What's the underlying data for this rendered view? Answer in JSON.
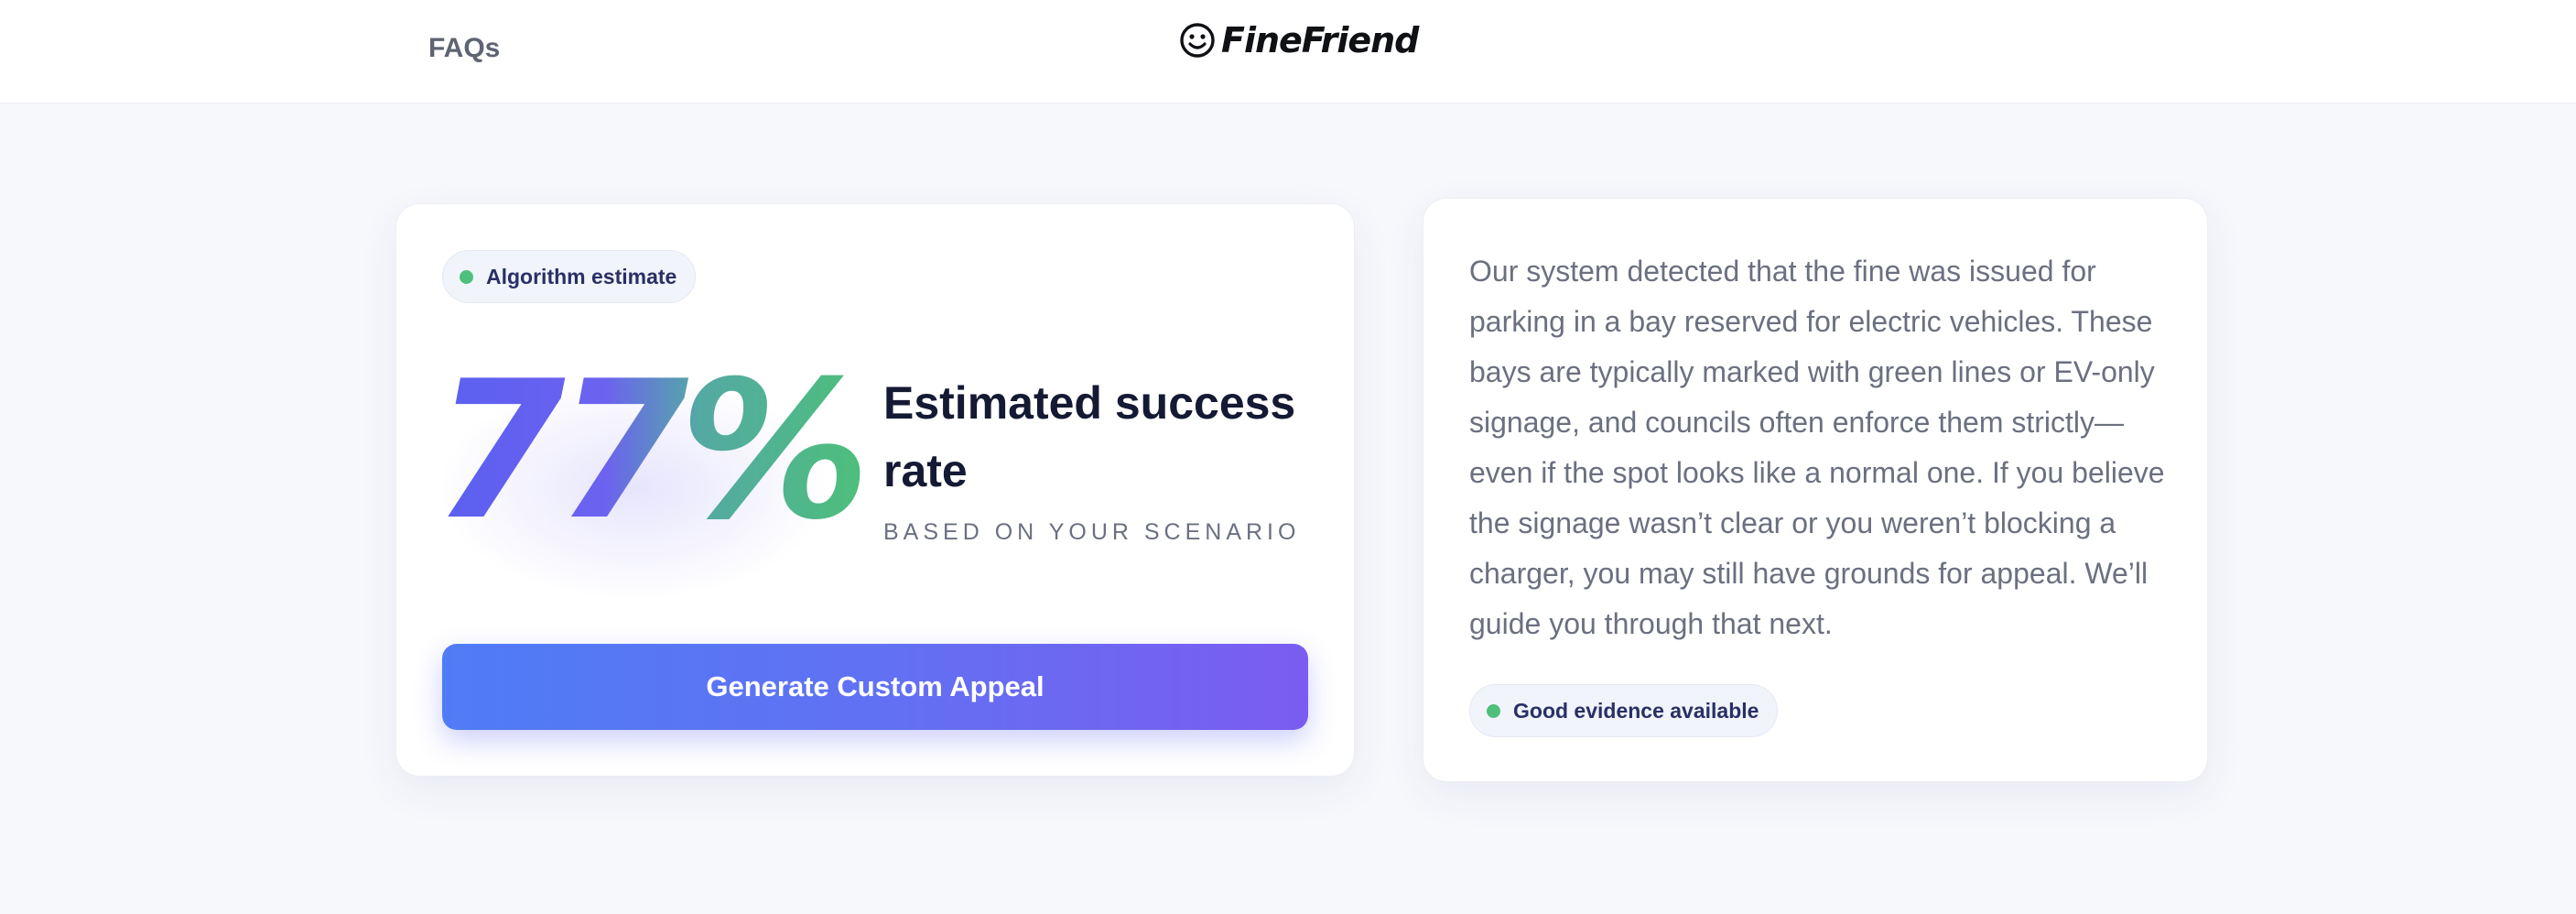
{
  "header": {
    "faqs_label": "FAQs",
    "logo_text": "FineFriend",
    "logo_icon": "smiley-face-icon"
  },
  "estimate_card": {
    "badge_label": "Algorithm estimate",
    "percent_display": "77%",
    "success_rate_percent": 77,
    "title": "Estimated success rate",
    "subtitle": "BASED ON YOUR SCENARIO",
    "cta_label": "Generate Custom Appeal"
  },
  "explanation_card": {
    "text": "Our system detected that the fine was issued for parking in a bay reserved for electric vehicles. These bays are typically marked with green lines or EV-only signage, and councils often enforce them strictly—even if the spot looks like a normal one. If you believe the signage wasn’t clear or you weren’t blocking a charger, you may still have grounds for appeal. We’ll guide you through that next.",
    "badge_label": "Good evidence available"
  },
  "colors": {
    "accent_blue": "#4f7cf6",
    "accent_purple": "#7b5cf1",
    "status_green": "#4fc07b",
    "heading_dark": "#141a33"
  }
}
